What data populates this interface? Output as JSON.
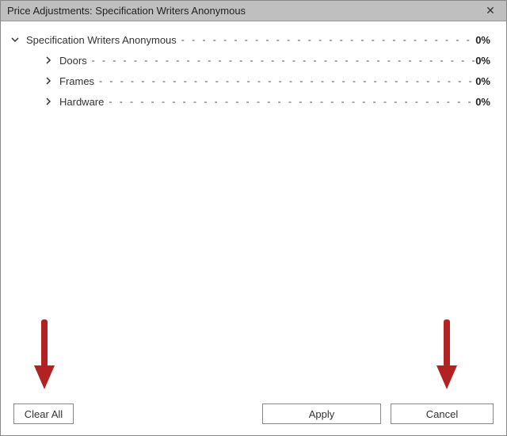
{
  "titlebar": {
    "title": "Price Adjustments: Specification Writers Anonymous",
    "close_glyph": "✕"
  },
  "tree": {
    "root": {
      "label": "Specification Writers Anonymous",
      "value": "0%",
      "expanded": true
    },
    "children": [
      {
        "label": "Doors",
        "value": "0%",
        "expanded": false
      },
      {
        "label": "Frames",
        "value": "0%",
        "expanded": false
      },
      {
        "label": "Hardware",
        "value": "0%",
        "expanded": false
      }
    ]
  },
  "buttons": {
    "clear_all": "Clear All",
    "apply": "Apply",
    "cancel": "Cancel"
  },
  "annotation": {
    "arrow_color": "#b22222"
  }
}
